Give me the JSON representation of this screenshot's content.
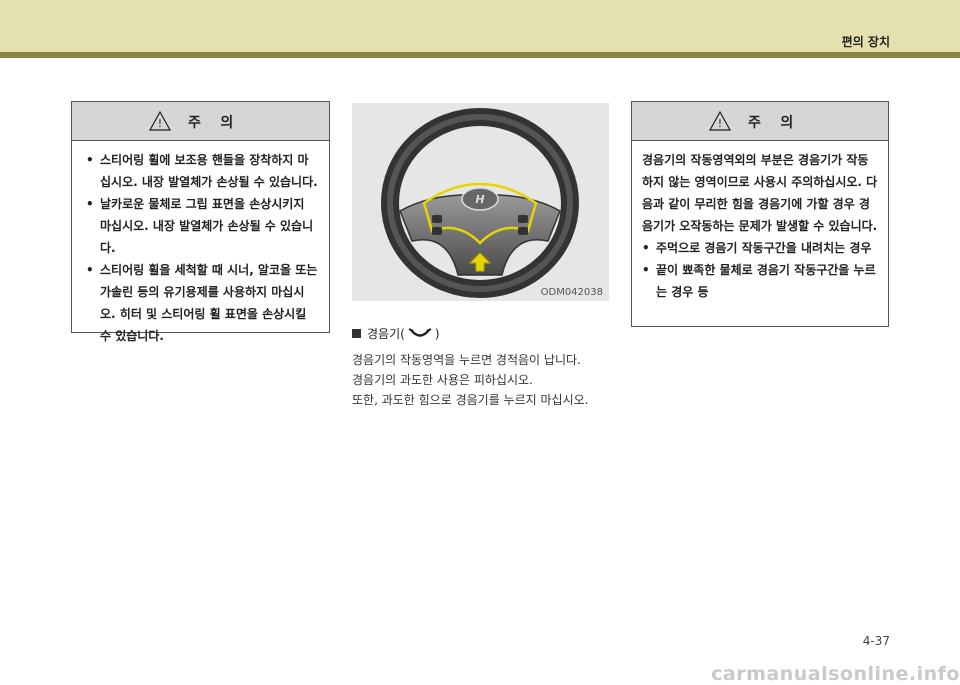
{
  "header": {
    "title": "편의 장치"
  },
  "caution_left": {
    "heading": "주    의",
    "items": [
      "스티어링 휠에 보조용 핸들을 장착하지 마십시오. 내장 발열체가 손상될 수 있습니다.",
      "날카로운 물체로 그립 표면을 손상시키지 마십시오. 내장 발열체가 손상될 수 있습니다.",
      "스티어링 휠을 세척할 때 시너, 알코올 또는 가솔린 등의 유기용제를 사용하지 마십시오. 히터 및 스티어링 휠 표면을 손상시킬 수 있습니다."
    ]
  },
  "figure": {
    "code": "ODM042038"
  },
  "horn_section": {
    "title_prefix": "경음기(",
    "title_suffix": ")",
    "icon": "horn-icon",
    "lines": [
      "경음기의 작동영역을 누르면 경적음이 납니다.",
      "경음기의 과도한 사용은 피하십시오.",
      "또한, 과도한 힘으로 경음기를 누르지 마십시오."
    ]
  },
  "caution_right": {
    "heading": "주    의",
    "paragraph": "경음기의 작동영역외의 부분은 경음기가 작동하지 않는 영역이므로 사용시 주의하십시오. 다음과 같이 무리한 힘을 경음기에 가할 경우 경음기가 오작동하는 문제가 발생할 수 있습니다.",
    "items": [
      "주먹으로 경음기 작동구간을 내려치는 경우",
      "끝이 뾰족한 물체로 경음기 작동구간을 누르는 경우 등"
    ]
  },
  "page_number": "4-37",
  "watermark": "carmanualsonline.info",
  "colors": {
    "header_bg": "#e4e1ae",
    "header_line": "#8b8640",
    "caution_head": "#d6d6d6",
    "highlight": "#e8d400"
  }
}
